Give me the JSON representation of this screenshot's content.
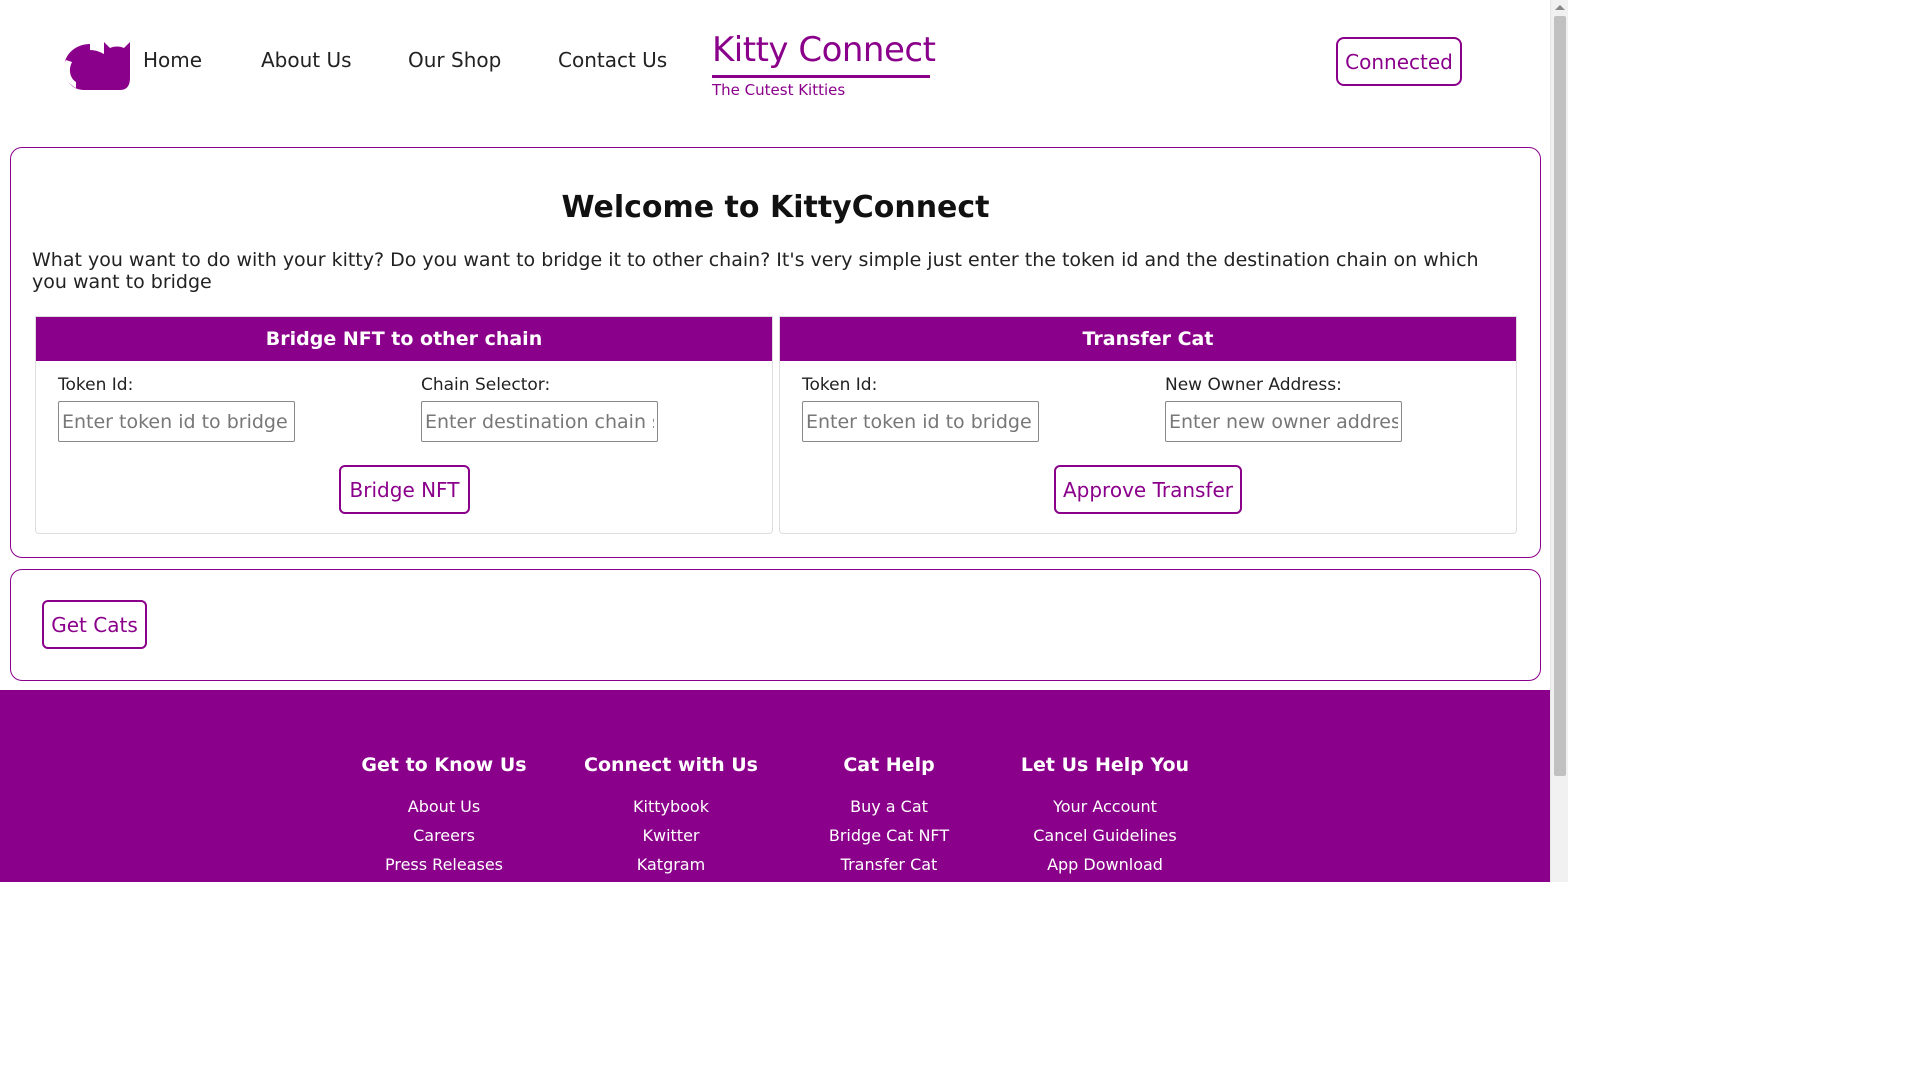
{
  "header": {
    "nav": [
      {
        "label": "Home"
      },
      {
        "label": "About Us"
      },
      {
        "label": "Our Shop"
      },
      {
        "label": "Contact Us"
      }
    ],
    "brand_title": "Kitty Connect",
    "brand_subtitle": "The Cutest Kitties",
    "connect_label": "Connected",
    "accent_color": "#8b008b"
  },
  "main": {
    "welcome": "Welcome to KittyConnect",
    "intro": "What you want to do with your kitty? Do you want to bridge it to other chain? It's very simple just enter the token id and the destination chain on which you want to bridge",
    "bridge": {
      "title": "Bridge NFT to other chain",
      "token_label": "Token Id:",
      "token_placeholder": "Enter token id to bridge",
      "chain_label": "Chain Selector:",
      "chain_placeholder": "Enter destination chain selector",
      "button": "Bridge NFT"
    },
    "transfer": {
      "title": "Transfer Cat",
      "token_label": "Token Id:",
      "token_placeholder": "Enter token id to bridge",
      "owner_label": "New Owner Address:",
      "owner_placeholder": "Enter new owner address",
      "button": "Approve Transfer"
    }
  },
  "cats": {
    "button": "Get Cats"
  },
  "footer": {
    "columns": [
      {
        "title": "Get to Know Us",
        "links": [
          "About Us",
          "Careers",
          "Press Releases"
        ]
      },
      {
        "title": "Connect with Us",
        "links": [
          "Kittybook",
          "Kwitter",
          "Katgram"
        ]
      },
      {
        "title": "Cat Help",
        "links": [
          "Buy a Cat",
          "Bridge Cat NFT",
          "Transfer Cat"
        ]
      },
      {
        "title": "Let Us Help You",
        "links": [
          "Your Account",
          "Cancel Guidelines",
          "App Download"
        ]
      }
    ]
  }
}
